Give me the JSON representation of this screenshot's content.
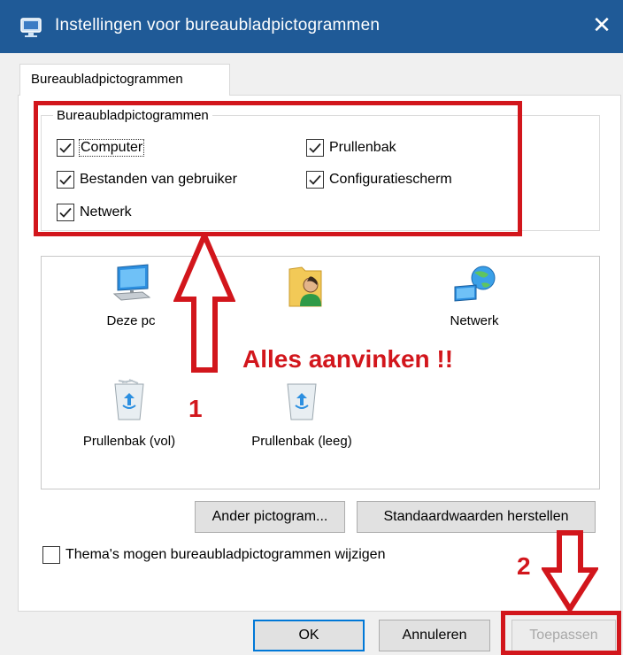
{
  "window": {
    "title": "Instellingen voor bureaubladpictogrammen",
    "close_glyph": "✕"
  },
  "tab": {
    "label": "Bureaubladpictogrammen"
  },
  "group": {
    "title": "Bureaubladpictogrammen",
    "checkboxes": [
      {
        "label": "Computer",
        "checked": true
      },
      {
        "label": "Prullenbak",
        "checked": true
      },
      {
        "label": "Bestanden van gebruiker",
        "checked": true
      },
      {
        "label": "Configuratiescherm",
        "checked": true
      },
      {
        "label": "Netwerk",
        "checked": true
      }
    ]
  },
  "preview": {
    "icons": [
      {
        "label": "Deze pc",
        "icon": "computer-icon"
      },
      {
        "label": "",
        "icon": "user-folder-icon"
      },
      {
        "label": "Netwerk",
        "icon": "network-icon"
      },
      {
        "label": "Prullenbak (vol)",
        "icon": "recycle-bin-full-icon"
      },
      {
        "label": "Prullenbak (leeg)",
        "icon": "recycle-bin-empty-icon"
      }
    ]
  },
  "buttons": {
    "change_icon": "Ander pictogram...",
    "restore_default": "Standaardwaarden herstellen",
    "ok": "OK",
    "cancel": "Annuleren",
    "apply": "Toepassen"
  },
  "theme_checkbox": {
    "label": "Thema's mogen bureaubladpictogrammen wijzigen",
    "checked": false
  },
  "annotations": {
    "main_text": "Alles aanvinken !!",
    "step1": "1",
    "step2": "2",
    "color": "#d2161c"
  },
  "colors": {
    "titlebar": "#1f5a97",
    "default_button_border": "#0078d7"
  }
}
